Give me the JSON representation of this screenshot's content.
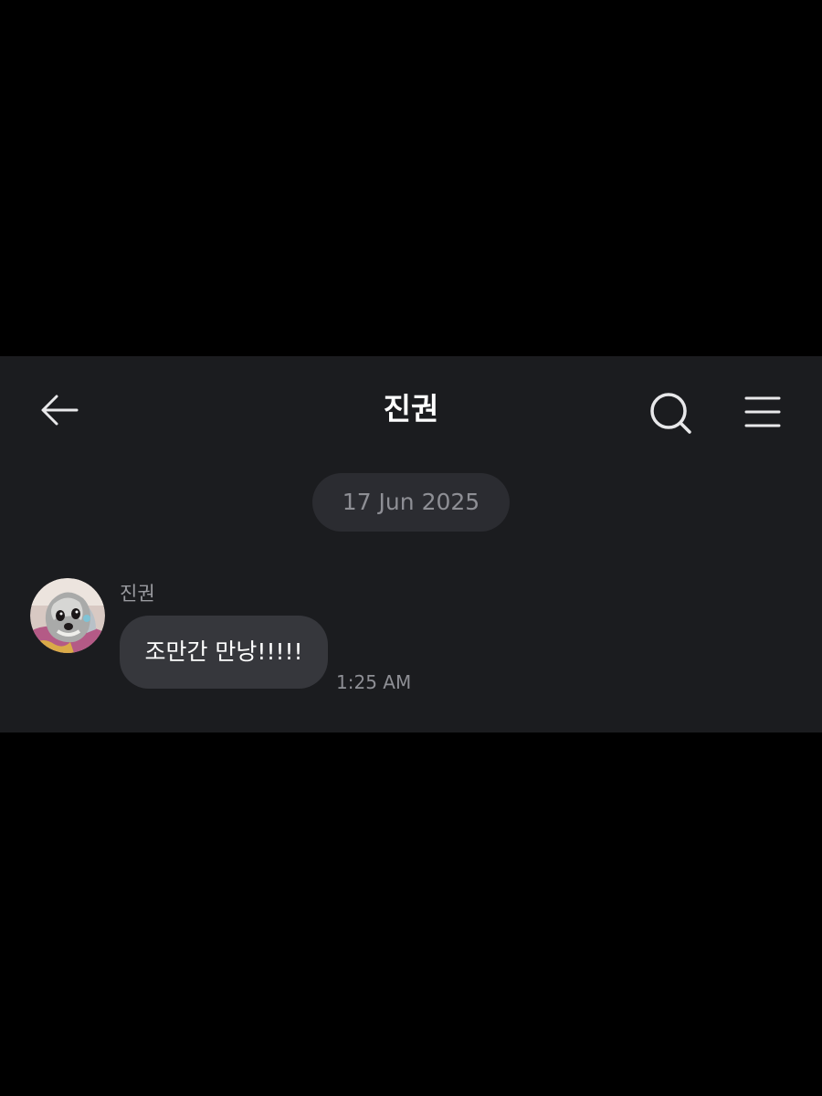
{
  "header": {
    "title": "진권",
    "back_icon": "arrow-left-icon",
    "search_icon": "search-icon",
    "menu_icon": "hamburger-menu-icon"
  },
  "date_separator": {
    "label": "17 Jun 2025"
  },
  "messages": [
    {
      "sender": "진권",
      "avatar": "dog-avatar",
      "text": "조만간 만낭!!!!!",
      "time": "1:25 AM"
    }
  ],
  "colors": {
    "background": "#000000",
    "chat_background": "#1b1c1f",
    "bubble": "#36373c",
    "date_pill": "#2b2c31",
    "muted_text": "#8e8f95",
    "primary_text": "#ffffff"
  }
}
